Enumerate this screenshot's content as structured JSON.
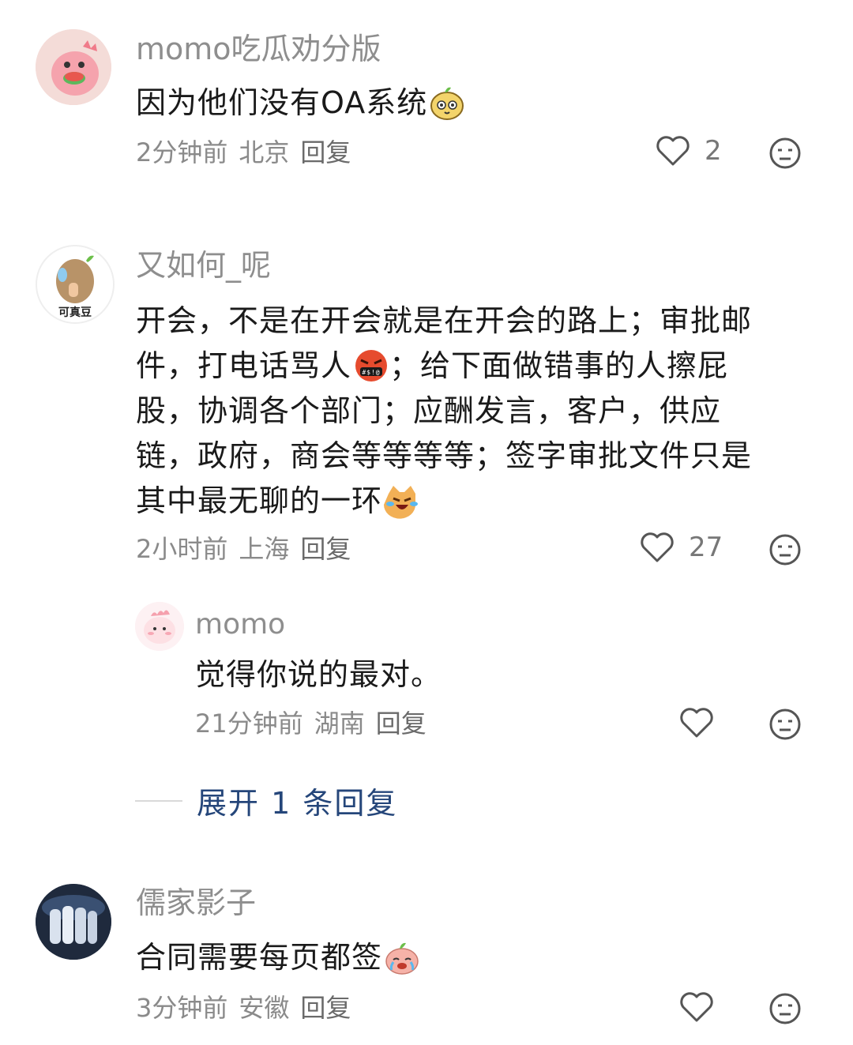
{
  "comments": [
    {
      "username": "momo吃瓜劝分版",
      "text": "因为他们没有OA系统",
      "emoji": "pear-face-emoji",
      "time": "2分钟前",
      "location": "北京",
      "reply": "回复",
      "likes": "2"
    },
    {
      "username": "又如何_呢",
      "avatar_caption": "可真豆",
      "text_lines": [
        "开会，不是在开会就是在开会的路上；审批邮",
        "件，打电话骂人",
        "；给下面做错事的人擦屁",
        "股，协调各个部门；应酬发言，客户，供应",
        "链，政府，商会等等等等；签字审批文件只是",
        "其中最无聊的一环"
      ],
      "time": "2小时前",
      "location": "上海",
      "reply": "回复",
      "likes": "27"
    },
    {
      "username": "儒家影子",
      "text": "合同需要每页都签",
      "time": "3分钟前",
      "location": "安徽",
      "reply": "回复",
      "likes": ""
    }
  ],
  "subreply": {
    "username": "momo",
    "text": "觉得你说的最对。",
    "time": "21分钟前",
    "location": "湖南",
    "reply": "回复"
  },
  "expand_label": "展开 1 条回复",
  "colors": {
    "username": "#8e8e8e",
    "expand": "#25467a",
    "meta": "#8a8a8a"
  },
  "icons": [
    "heart-outline-icon",
    "neutral-face-icon"
  ]
}
